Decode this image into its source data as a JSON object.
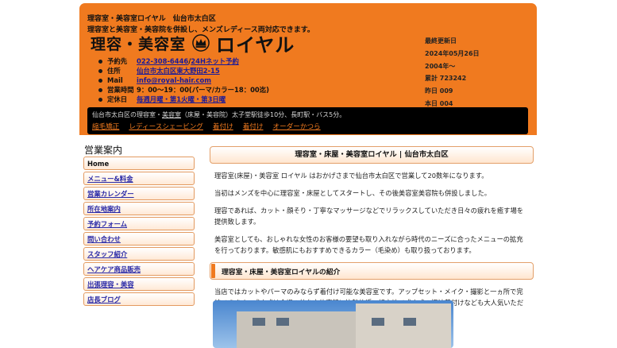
{
  "header": {
    "tagline1": "理容室・美容室ロイヤル　仙台市太白区",
    "tagline2": "理容室と美容室・美容院を併設し、メンズレディース両対応できます。",
    "logo_jp": "理容・美容室",
    "logo_kana": "ロイヤル",
    "info": {
      "reservation_label": "予約先",
      "phone": "022-308-6446",
      "separator": " / ",
      "net_reserve": "24Hネット予約",
      "address_label": "住所",
      "address": "仙台市太白区東大野田2-15",
      "mail_label": "Mail",
      "mail": "info@royal-hair.com",
      "hours_label": "営業時間",
      "hours": "9：00～19：00(パーマ/カラー18：00迄)",
      "closed_label": "定休日",
      "closed": "毎週月曜・第1火曜・第3日曜"
    },
    "side_info": {
      "updated_label": "最終更新日",
      "updated_date": "2024年05月26日",
      "since": "2004年～",
      "total": "累計 723242",
      "yesterday": "昨日 009",
      "today": "本日 004"
    },
    "address_note_pre": "仙台市太白区の理容室・",
    "address_note_link": "美容室",
    "address_note_post": "（床屋・美容院）太子堂駅徒歩10分、長町駅・バス5分。",
    "nav": [
      "縮毛矯正",
      "レディースシェービング",
      "着付け",
      "着付け",
      "オーダーかつら"
    ]
  },
  "sidebar": {
    "title": "営業案内",
    "items": [
      "Home",
      "メニュー&料金",
      "営業カレンダー",
      "所在地案内",
      "予約フォーム",
      "問い合わせ",
      "スタッフ紹介",
      "ヘアケア商品販売",
      "出張理容・美容",
      "店長ブログ"
    ]
  },
  "content": {
    "title": "理容室・床屋・美容室ロイヤル | 仙台市太白区",
    "p1": "理容室(床屋)・美容室 ロイヤル はおかげさまで仙台市太白区で営業して20数年になります。",
    "p2": "当初はメンズを中心に理容室・床屋としてスタートし、その後美容室美容院も併設しました。",
    "p3": "理容であれば、カット・顔そり・丁寧なマッサージなどでリラックスしていただき日々の疲れを癒す場を提供致します。",
    "p4": "美容室としても、おしゃれな女性のお客様の要望も取り入れながら時代のニーズに合ったメニューの拡充を行っております。敏感肌にもおすすめできるカラー（毛染め）も取り扱っております。",
    "subhead": "理容室・床屋・美容室ロイヤルの紹介",
    "p5": "当店ではカットやパーマのみならず着付け可能な美容室です。アップセット・メイク・撮影と一ヵ所で完結できます。成人式は会場の仙台市体育館に比較的近い好立地で成人式の振袖着付けなども大人気いただいております。"
  },
  "colors": {
    "accent": "#f07a1f",
    "link": "#1a1a9a"
  }
}
